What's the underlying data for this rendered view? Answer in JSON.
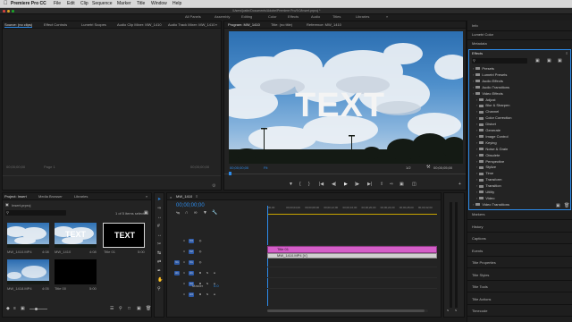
{
  "menubar": {
    "apple": "",
    "app_name": "Premiere Pro CC",
    "items": [
      "File",
      "Edit",
      "Clip",
      "Sequence",
      "Marker",
      "Title",
      "Window",
      "Help"
    ]
  },
  "titlebar": {
    "path": "/Users/justin/Documents/Adobe/Premiere Pro/9.0/Insert.prproj *"
  },
  "workspaces": {
    "items": [
      "All Panels",
      "Assembly",
      "Editing",
      "Color",
      "Effects",
      "Audio",
      "Titles",
      "Libraries"
    ],
    "more": "»"
  },
  "source_panel": {
    "tabs": [
      "Source: (no clips)",
      "Effect Controls",
      "Lumetri Scopes",
      "Audio Clip Mixer: MW_1410",
      "Audio Track Mixer: MW_1410"
    ],
    "more": "»",
    "timecode_left": "00;00;00;00",
    "timecode_right": "00;00;00;00",
    "page": "Page 1"
  },
  "program_panel": {
    "tabs": [
      "Program: MW_1410",
      "Title: (no title)",
      "Reference: MW_1410"
    ],
    "overlay_text": "TEXT",
    "timecode": "00;00;00;00",
    "fit": "Fit",
    "quality": "1/2",
    "duration": "00;00;05;00"
  },
  "right_panels": {
    "top": [
      "Info",
      "Lumetri Color",
      "Metadata"
    ],
    "effects_title": "Effects",
    "search_placeholder": "",
    "tree": [
      {
        "label": "Presets",
        "indent": 0
      },
      {
        "label": "Lumetri Presets",
        "indent": 0
      },
      {
        "label": "Audio Effects",
        "indent": 0
      },
      {
        "label": "Audio Transitions",
        "indent": 0
      },
      {
        "label": "Video Effects",
        "indent": 0
      },
      {
        "label": "Adjust",
        "indent": 1
      },
      {
        "label": "Blur & Sharpen",
        "indent": 1
      },
      {
        "label": "Channel",
        "indent": 1
      },
      {
        "label": "Color Correction",
        "indent": 1
      },
      {
        "label": "Distort",
        "indent": 1
      },
      {
        "label": "Generate",
        "indent": 1
      },
      {
        "label": "Image Control",
        "indent": 1
      },
      {
        "label": "Keying",
        "indent": 1
      },
      {
        "label": "Noise & Grain",
        "indent": 1
      },
      {
        "label": "Obsolete",
        "indent": 1
      },
      {
        "label": "Perspective",
        "indent": 1
      },
      {
        "label": "Stylize",
        "indent": 1
      },
      {
        "label": "Time",
        "indent": 1
      },
      {
        "label": "Transform",
        "indent": 1
      },
      {
        "label": "Transition",
        "indent": 1
      },
      {
        "label": "Utility",
        "indent": 1
      },
      {
        "label": "Video",
        "indent": 1
      },
      {
        "label": "Video Transitions",
        "indent": 0
      }
    ],
    "bottom": [
      "Markers",
      "History",
      "Captions",
      "Events",
      "Title Properties",
      "Title Styles",
      "Title Tools",
      "Title Actions",
      "Timecode"
    ]
  },
  "project_panel": {
    "tabs": [
      "Project: Insert",
      "Media Browser",
      "Libraries"
    ],
    "more": "»",
    "project_file": "Insert.prproj",
    "selection": "1 of 5 items selected",
    "items": [
      {
        "name": "MW_1410.MP4",
        "dur": "4:08",
        "kind": "sky"
      },
      {
        "name": "MW_1410",
        "dur": "4:08",
        "kind": "sky-text"
      },
      {
        "name": "Title 01",
        "dur": "5:00",
        "kind": "title"
      },
      {
        "name": "MW_1418.MP4",
        "dur": "4:05",
        "kind": "sky2"
      },
      {
        "name": "Title 00",
        "dur": "5:00",
        "kind": "black"
      }
    ],
    "thumb_title_text": "TEXT"
  },
  "timeline": {
    "tab": "MW_1410",
    "timecode": "00;00;00;00",
    "ruler": [
      ":00;00",
      "00;00;04;00",
      "00;00;08;00",
      "00;00;12;00",
      "00;00;16;00",
      "00;00;20;00",
      "00;00;24;00",
      "00;00;28;00",
      "00;00;32;00"
    ],
    "tracks": [
      {
        "id": "V3"
      },
      {
        "id": "V2"
      },
      {
        "id": "V1"
      },
      {
        "id": "A1"
      },
      {
        "id": "A2"
      },
      {
        "id": "A3"
      }
    ],
    "source_patch": [
      "V1",
      "A1"
    ],
    "master": "Master",
    "master_val": "0.0",
    "clips": [
      {
        "label": "Title 01",
        "color": "#d45ec8"
      },
      {
        "label": "MW_1410.MP4 [V]",
        "color": "#cfcfcf"
      }
    ]
  },
  "colors": {
    "accent": "#2d8ceb",
    "title_clip": "#d45ec8",
    "menubar_bg": "#d8d8d8",
    "panel_bg": "#232323"
  }
}
